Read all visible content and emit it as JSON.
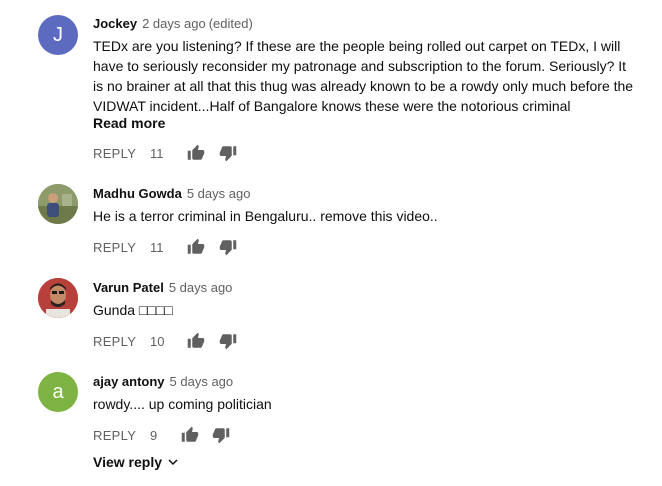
{
  "comments": [
    {
      "author": "Jockey",
      "time": "2 days ago",
      "edited": "(edited)",
      "avatar_letter": "J",
      "avatar_color": "#5c6bc0",
      "text": "TEDx are you listening? If these are the people being rolled out carpet on TEDx, I will have to seriously reconsider my patronage and subscription to the forum. Seriously? It is no brainer at all that this thug was already known to be a rowdy only much before the VIDWAT incident...Half of Bangalore knows these were the notorious criminal",
      "read_more": "Read more",
      "reply_label": "REPLY",
      "likes": "11"
    },
    {
      "author": "Madhu Gowda",
      "time": "5 days ago",
      "text": "He is a terror criminal in Bengaluru.. remove this video..",
      "reply_label": "REPLY",
      "likes": "11"
    },
    {
      "author": "Varun Patel",
      "time": "5 days ago",
      "text": "Gunda □□□□",
      "reply_label": "REPLY",
      "likes": "10"
    },
    {
      "author": "ajay antony",
      "time": "5 days ago",
      "avatar_letter": "a",
      "avatar_color": "#7cb342",
      "text": "rowdy.... up coming politician",
      "reply_label": "REPLY",
      "likes": "9"
    }
  ],
  "view_reply": "View reply",
  "icons": {
    "like": "thumbs-up-icon",
    "dislike": "thumbs-down-icon",
    "expand": "chevron-down-icon"
  },
  "colors": {
    "meta_text": "#606060",
    "icon": "#606060"
  }
}
